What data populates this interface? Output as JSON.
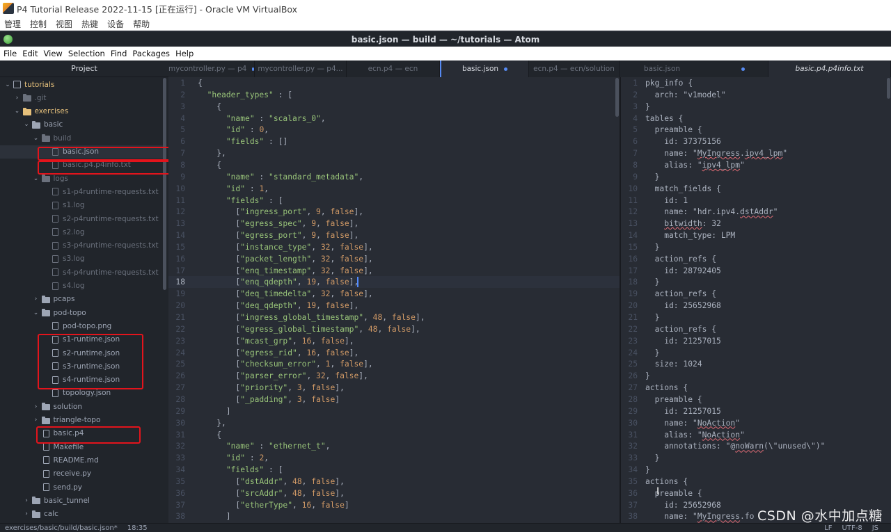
{
  "vbox": {
    "title": "P4 Tutorial Release 2022-11-15 [正在运行] - Oracle VM VirtualBox",
    "menu": [
      "管理",
      "控制",
      "视图",
      "热键",
      "设备",
      "帮助"
    ]
  },
  "atom": {
    "window_title": "basic.json — build — ~/tutorials — Atom",
    "menu": [
      "File",
      "Edit",
      "View",
      "Selection",
      "Find",
      "Packages",
      "Help"
    ]
  },
  "tree": {
    "header": "Project",
    "items": [
      {
        "label": "tutorials",
        "kind": "repo",
        "depth": 0,
        "arrow": "⌄",
        "state": "modified"
      },
      {
        "label": ".git",
        "kind": "folder",
        "depth": 1,
        "arrow": "›",
        "state": "ignored"
      },
      {
        "label": "exercises",
        "kind": "folder",
        "depth": 1,
        "arrow": "⌄",
        "state": "modified"
      },
      {
        "label": "basic",
        "kind": "folder",
        "depth": 2,
        "arrow": "⌄",
        "state": "normal"
      },
      {
        "label": "build",
        "kind": "folder",
        "depth": 3,
        "arrow": "⌄",
        "state": "ignored"
      },
      {
        "label": "basic.json",
        "kind": "file",
        "depth": 4,
        "arrow": "",
        "state": "selected-ignored"
      },
      {
        "label": "basic.p4.p4info.txt",
        "kind": "file",
        "depth": 4,
        "arrow": "",
        "state": "ignored"
      },
      {
        "label": "logs",
        "kind": "folder",
        "depth": 3,
        "arrow": "⌄",
        "state": "ignored"
      },
      {
        "label": "s1-p4runtime-requests.txt",
        "kind": "file",
        "depth": 4,
        "arrow": "",
        "state": "ignored"
      },
      {
        "label": "s1.log",
        "kind": "file",
        "depth": 4,
        "arrow": "",
        "state": "ignored"
      },
      {
        "label": "s2-p4runtime-requests.txt",
        "kind": "file",
        "depth": 4,
        "arrow": "",
        "state": "ignored"
      },
      {
        "label": "s2.log",
        "kind": "file",
        "depth": 4,
        "arrow": "",
        "state": "ignored"
      },
      {
        "label": "s3-p4runtime-requests.txt",
        "kind": "file",
        "depth": 4,
        "arrow": "",
        "state": "ignored"
      },
      {
        "label": "s3.log",
        "kind": "file",
        "depth": 4,
        "arrow": "",
        "state": "ignored"
      },
      {
        "label": "s4-p4runtime-requests.txt",
        "kind": "file",
        "depth": 4,
        "arrow": "",
        "state": "ignored"
      },
      {
        "label": "s4.log",
        "kind": "file",
        "depth": 4,
        "arrow": "",
        "state": "ignored"
      },
      {
        "label": "pcaps",
        "kind": "folder",
        "depth": 3,
        "arrow": "›",
        "state": "normal"
      },
      {
        "label": "pod-topo",
        "kind": "folder",
        "depth": 3,
        "arrow": "⌄",
        "state": "normal"
      },
      {
        "label": "pod-topo.png",
        "kind": "file",
        "depth": 4,
        "arrow": "",
        "state": "normal"
      },
      {
        "label": "s1-runtime.json",
        "kind": "file",
        "depth": 4,
        "arrow": "",
        "state": "normal"
      },
      {
        "label": "s2-runtime.json",
        "kind": "file",
        "depth": 4,
        "arrow": "",
        "state": "normal"
      },
      {
        "label": "s3-runtime.json",
        "kind": "file",
        "depth": 4,
        "arrow": "",
        "state": "normal"
      },
      {
        "label": "s4-runtime.json",
        "kind": "file",
        "depth": 4,
        "arrow": "",
        "state": "normal"
      },
      {
        "label": "topology.json",
        "kind": "file",
        "depth": 4,
        "arrow": "",
        "state": "normal"
      },
      {
        "label": "solution",
        "kind": "folder",
        "depth": 3,
        "arrow": "›",
        "state": "normal"
      },
      {
        "label": "triangle-topo",
        "kind": "folder",
        "depth": 3,
        "arrow": "›",
        "state": "normal"
      },
      {
        "label": "basic.p4",
        "kind": "file",
        "depth": 3,
        "arrow": "",
        "state": "normal"
      },
      {
        "label": "Makefile",
        "kind": "file",
        "depth": 3,
        "arrow": "",
        "state": "normal"
      },
      {
        "label": "README.md",
        "kind": "file",
        "depth": 3,
        "arrow": "",
        "state": "normal"
      },
      {
        "label": "receive.py",
        "kind": "file",
        "depth": 3,
        "arrow": "",
        "state": "normal"
      },
      {
        "label": "send.py",
        "kind": "file",
        "depth": 3,
        "arrow": "",
        "state": "normal"
      },
      {
        "label": "basic_tunnel",
        "kind": "folder",
        "depth": 2,
        "arrow": "›",
        "state": "normal"
      },
      {
        "label": "calc",
        "kind": "folder",
        "depth": 2,
        "arrow": "›",
        "state": "normal"
      }
    ]
  },
  "tabs": [
    {
      "label": "mycontroller.py — p4",
      "modified": true,
      "active": false
    },
    {
      "label": "mycontroller.py — p4...",
      "modified": false,
      "active": false
    },
    {
      "label": "ecn.p4 — ecn",
      "modified": false,
      "active": false
    },
    {
      "label": "basic.json",
      "modified": true,
      "active": true
    },
    {
      "label": "ecn.p4 — ecn/solution",
      "modified": false,
      "active": false
    },
    {
      "label": "basic.json",
      "modified": true,
      "active": false
    },
    {
      "label": "basic.p4.p4info.txt",
      "modified": false,
      "active": true
    }
  ],
  "left_editor": {
    "start_line": 1,
    "cursor_line": 18,
    "lines": [
      "{",
      "  \"header_types\" : [",
      "    {",
      "      \"name\" : \"scalars_0\",",
      "      \"id\" : 0,",
      "      \"fields\" : []",
      "    },",
      "    {",
      "      \"name\" : \"standard_metadata\",",
      "      \"id\" : 1,",
      "      \"fields\" : [",
      "        [\"ingress_port\", 9, false],",
      "        [\"egress_spec\", 9, false],",
      "        [\"egress_port\", 9, false],",
      "        [\"instance_type\", 32, false],",
      "        [\"packet_length\", 32, false],",
      "        [\"enq_timestamp\", 32, false],",
      "        [\"enq_qdepth\", 19, false],",
      "        [\"deq_timedelta\", 32, false],",
      "        [\"deq_qdepth\", 19, false],",
      "        [\"ingress_global_timestamp\", 48, false],",
      "        [\"egress_global_timestamp\", 48, false],",
      "        [\"mcast_grp\", 16, false],",
      "        [\"egress_rid\", 16, false],",
      "        [\"checksum_error\", 1, false],",
      "        [\"parser_error\", 32, false],",
      "        [\"priority\", 3, false],",
      "        [\"_padding\", 3, false]",
      "      ]",
      "    },",
      "    {",
      "      \"name\" : \"ethernet_t\",",
      "      \"id\" : 2,",
      "      \"fields\" : [",
      "        [\"dstAddr\", 48, false],",
      "        [\"srcAddr\", 48, false],",
      "        [\"etherType\", 16, false]",
      "      ]"
    ]
  },
  "right_editor": {
    "start_line": 1,
    "lines": [
      "pkg_info {",
      "  arch: \"v1model\"",
      "}",
      "tables {",
      "  preamble {",
      "    id: 37375156",
      "    name: \"MyIngress.ipv4_lpm\"",
      "    alias: \"ipv4_lpm\"",
      "  }",
      "  match_fields {",
      "    id: 1",
      "    name: \"hdr.ipv4.dstAddr\"",
      "    bitwidth: 32",
      "    match_type: LPM",
      "  }",
      "  action_refs {",
      "    id: 28792405",
      "  }",
      "  action_refs {",
      "    id: 25652968",
      "  }",
      "  action_refs {",
      "    id: 21257015",
      "  }",
      "  size: 1024",
      "}",
      "actions {",
      "  preamble {",
      "    id: 21257015",
      "    name: \"NoAction\"",
      "    alias: \"NoAction\"",
      "    annotations: \"@noWarn(\\\"unused\\\")\"",
      "  }",
      "}",
      "actions {",
      "  preamble {",
      "    id: 25652968",
      "    name: \"MyIngress.fo"
    ]
  },
  "statusbar": {
    "path": "exercises/basic/build/basic.json*",
    "position": "18:35",
    "line_ending": "LF",
    "encoding": "UTF-8",
    "grammar": "JS"
  },
  "watermark": "CSDN @水中加点糖",
  "highlight_boxes": [
    "basic.json",
    "basic.p4.p4info.txt",
    "s1-runtime.json … s4-runtime.json",
    "basic.p4"
  ],
  "colors": {
    "highlight_box": "#e3141c",
    "modified_dot": "#568af2",
    "string": "#98c379",
    "number": "#d19a66"
  }
}
